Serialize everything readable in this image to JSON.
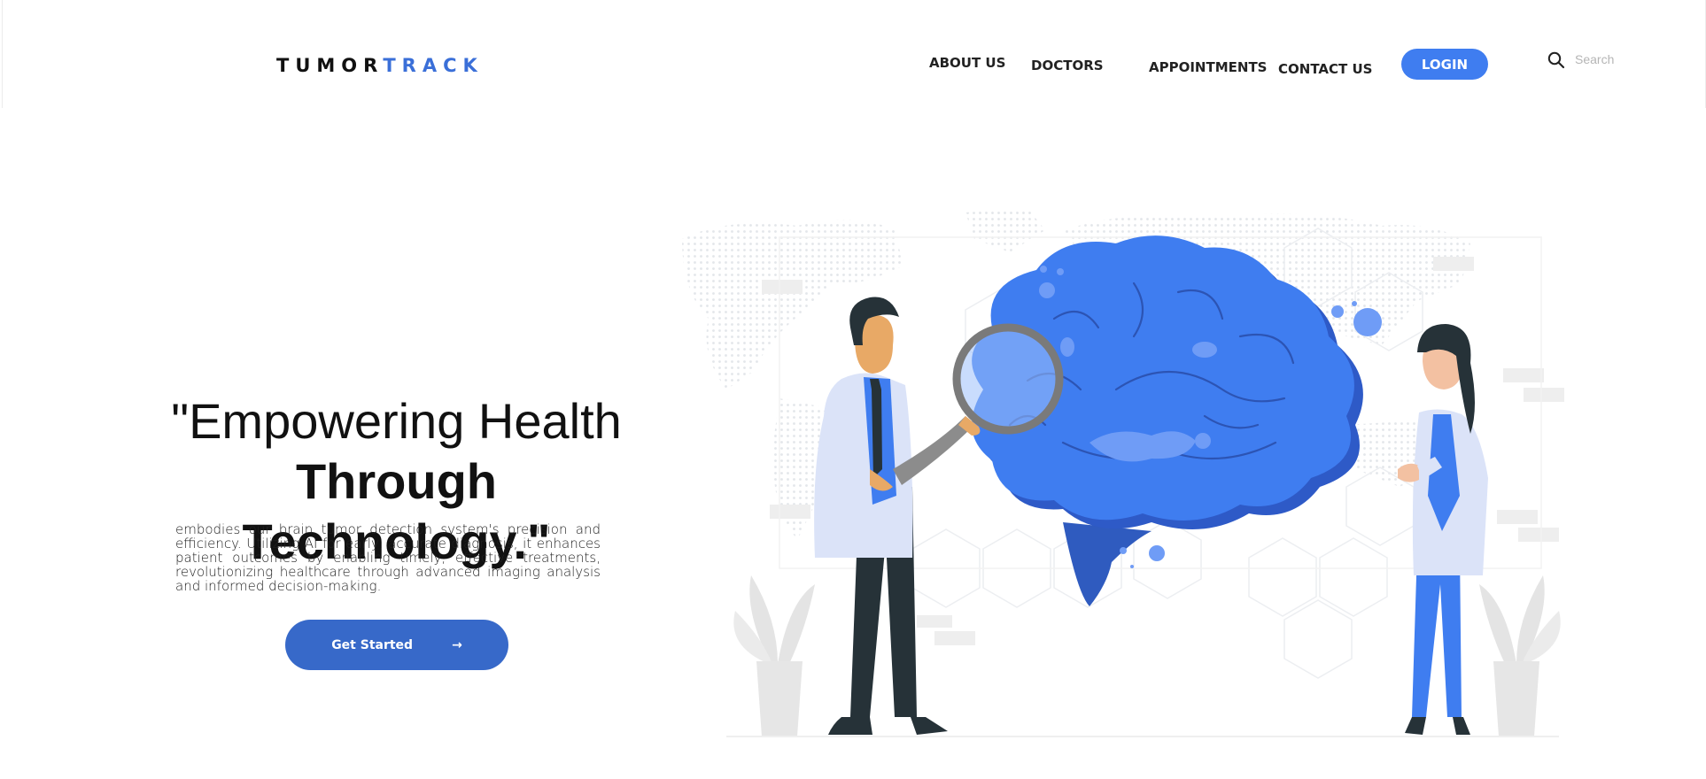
{
  "header": {
    "logo_part1": "TUMOR",
    "logo_part2": "TRACK",
    "nav": {
      "about": "ABOUT US",
      "doctors": "DOCTORS",
      "appointments": "APPOINTMENTS",
      "contact": "CONTACT US"
    },
    "login_label": "LOGIN",
    "search": {
      "placeholder": "Search",
      "icon": "search-icon"
    }
  },
  "hero": {
    "title_line1": "\"Empowering Health",
    "title_line2_bold": "Through Technology",
    "title_line2_end": ".\"",
    "description": "embodies our brain tumor detection system's precision and efficiency. Utilizing AI for early, accurate diagnosis, it enhances patient outcomes by enabling timely, effective treatments, revolutionizing healthcare through advanced imaging analysis and informed decision-making.",
    "cta_label": "Get Started",
    "cta_icon": "arrow-right-icon",
    "cta_arrow": "→"
  },
  "colors": {
    "accent": "#3f7df0",
    "cta": "#3769c9",
    "logo_blue": "#3a6fd8",
    "brain": "#3f7df0"
  }
}
